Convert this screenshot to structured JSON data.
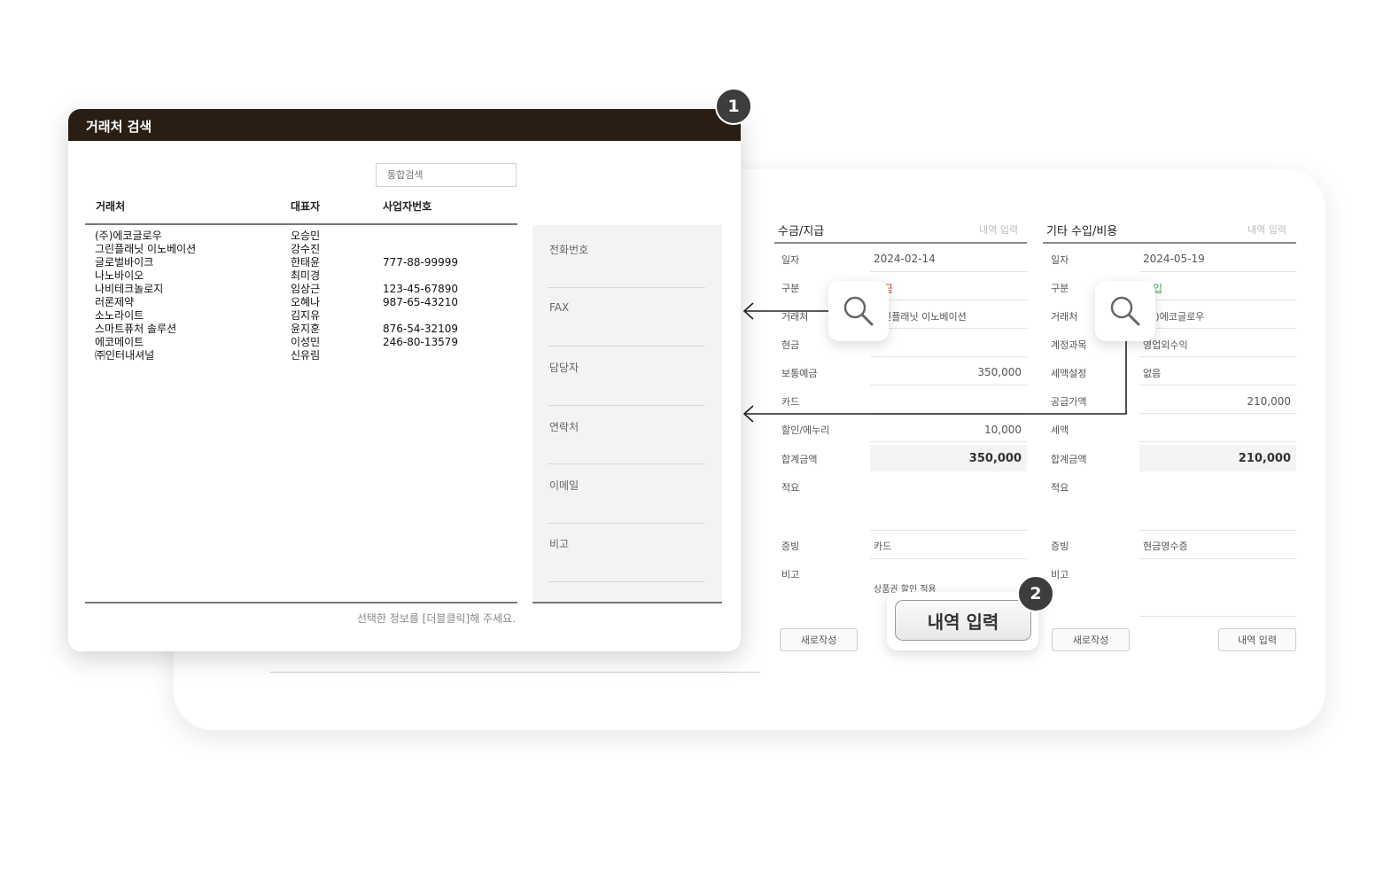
{
  "dialog": {
    "title": "거래처 검색",
    "search_placeholder": "통합검색",
    "columns": [
      "거래처",
      "대표자",
      "사업자번호"
    ],
    "rows": [
      {
        "name": "(주)에코글로우",
        "rep": "오승민",
        "bizno": ""
      },
      {
        "name": "그린플래닛 이노베이션",
        "rep": "강수진",
        "bizno": ""
      },
      {
        "name": "글로벌바이크",
        "rep": "한태윤",
        "bizno": "777-88-99999"
      },
      {
        "name": "나노바이오",
        "rep": "최미경",
        "bizno": ""
      },
      {
        "name": "나비테크놀로지",
        "rep": "임상근",
        "bizno": "123-45-67890"
      },
      {
        "name": "러론제약",
        "rep": "오혜나",
        "bizno": "987-65-43210"
      },
      {
        "name": "소노라이트",
        "rep": "김지유",
        "bizno": ""
      },
      {
        "name": "스마트퓨처 솔루션",
        "rep": "윤지훈",
        "bizno": "876-54-32109"
      },
      {
        "name": "에코메이트",
        "rep": "이성민",
        "bizno": "246-80-13579"
      },
      {
        "name": "㈜인터내셔널",
        "rep": "신유림",
        "bizno": ""
      }
    ],
    "detail_labels": [
      "전화번호",
      "FAX",
      "담당자",
      "연락처",
      "이메일",
      "비고"
    ],
    "footer_hint": "선택한 정보를 [더블클릭]해 주세요."
  },
  "panel_a": {
    "title": "수금/지급",
    "link": "내역 입력",
    "fields": [
      {
        "label": "일자",
        "value": "2024-02-14"
      },
      {
        "label": "구분",
        "value": "수금"
      },
      {
        "label": "거래처",
        "value": "그린플래닛 이노베이션"
      },
      {
        "label": "현금",
        "value": ""
      },
      {
        "label": "보통예금",
        "value": "350,000"
      },
      {
        "label": "카드",
        "value": ""
      },
      {
        "label": "할인/에누리",
        "value": "10,000"
      },
      {
        "label": "합계금액",
        "value": "350,000"
      },
      {
        "label": "적요",
        "value": ""
      },
      {
        "label": "증빙",
        "value": "카드"
      },
      {
        "label": "비고",
        "value": "상품권 할인 적용"
      }
    ],
    "new_button": "새로작성"
  },
  "panel_b": {
    "title": "기타 수입/비용",
    "link": "내역 입력",
    "fields": [
      {
        "label": "일자",
        "value": "2024-05-19"
      },
      {
        "label": "구분",
        "value": "수입"
      },
      {
        "label": "거래처",
        "value": "(주)에코글로우"
      },
      {
        "label": "계정과목",
        "value": "영업외수익"
      },
      {
        "label": "세액설정",
        "value": "없음"
      },
      {
        "label": "공급가액",
        "value": "210,000"
      },
      {
        "label": "세액",
        "value": ""
      },
      {
        "label": "합계금액",
        "value": "210,000"
      },
      {
        "label": "적요",
        "value": ""
      },
      {
        "label": "증빙",
        "value": "현금영수증"
      },
      {
        "label": "비고",
        "value": ""
      }
    ],
    "new_button": "새로작성",
    "entry_button": "내역 입력"
  },
  "callout": {
    "entry_button": "내역 입력"
  },
  "badges": {
    "one": "1",
    "two": "2"
  },
  "colors": {
    "dialog_header": "#2a1e14",
    "badge": "#3d3d3d",
    "red_mark": "#e04a3a",
    "green_mark": "#3aa55a"
  },
  "icons": [
    "search-icon",
    "arrow-left-icon"
  ]
}
